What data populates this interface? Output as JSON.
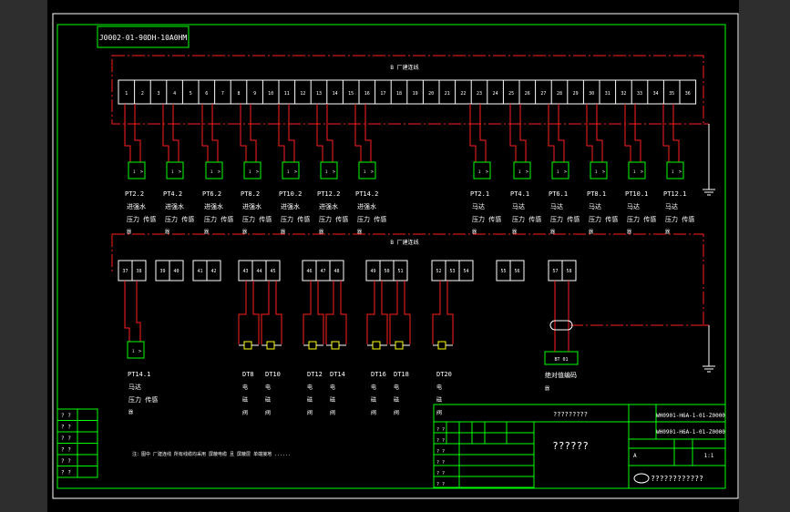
{
  "colors": {
    "frame": "#ffffff",
    "border": "#00ff00",
    "dash": "#ff2020",
    "wire": "#ff2020",
    "box_yellow": "#ffff00",
    "box_green": "#00ff00",
    "cyan": "#00ffff",
    "text": "#ffffff",
    "side": "#2e2e2e"
  },
  "header": {
    "code_tag": "J0002-01-90DH-10A0HM"
  },
  "top_bus": {
    "label": "B  厂建连线",
    "terminals": [
      "1",
      "2",
      "3",
      "4",
      "5",
      "6",
      "7",
      "8",
      "9",
      "10",
      "11",
      "12",
      "13",
      "14",
      "15",
      "16",
      "17",
      "18",
      "19",
      "20",
      "21",
      "22",
      "23",
      "24",
      "25",
      "26",
      "27",
      "28",
      "29",
      "30",
      "31",
      "32",
      "33",
      "34",
      "35",
      "36"
    ]
  },
  "top_sensors": [
    {
      "id": "PT2.2",
      "l1": "进强水",
      "l2": "压力 传感",
      "l3": "器"
    },
    {
      "id": "PT4.2",
      "l1": "进强水",
      "l2": "压力 传感",
      "l3": "器"
    },
    {
      "id": "PT6.2",
      "l1": "进强水",
      "l2": "压力 传感",
      "l3": "器"
    },
    {
      "id": "PT8.2",
      "l1": "进强水",
      "l2": "压力 传感",
      "l3": "器"
    },
    {
      "id": "PT10.2",
      "l1": "进强水",
      "l2": "压力 传感",
      "l3": "器"
    },
    {
      "id": "PT12.2",
      "l1": "进强水",
      "l2": "压力 传感",
      "l3": "器"
    },
    {
      "id": "PT14.2",
      "l1": "进强水",
      "l2": "压力 传感",
      "l3": "器"
    },
    {
      "id": "PT2.1",
      "l1": "马达",
      "l2": "压力 传感",
      "l3": "器"
    },
    {
      "id": "PT4.1",
      "l1": "马达",
      "l2": "压力 传感",
      "l3": "器"
    },
    {
      "id": "PT6.1",
      "l1": "马达",
      "l2": "压力 传感",
      "l3": "器"
    },
    {
      "id": "PT8.1",
      "l1": "马达",
      "l2": "压力 传感",
      "l3": "器"
    },
    {
      "id": "PT10.1",
      "l1": "马达",
      "l2": "压力 传感",
      "l3": "器"
    },
    {
      "id": "PT12.1",
      "l1": "马达",
      "l2": "压力 传感",
      "l3": "器"
    }
  ],
  "bottom_bus": {
    "label": "B  厂建连线",
    "groups": [
      [
        "37",
        "38"
      ],
      [
        "39",
        "40"
      ],
      [
        "41",
        "42"
      ],
      [
        "43",
        "44",
        "45"
      ],
      [
        "46",
        "47",
        "48"
      ],
      [
        "49",
        "50",
        "51"
      ],
      [
        "52",
        "53",
        "54"
      ],
      [
        "55",
        "56"
      ],
      [
        "57",
        "58"
      ]
    ]
  },
  "bottom_sensor": {
    "id": "PT14.1",
    "l1": "马达",
    "l2": "压力 传感",
    "l3": "器"
  },
  "valves": [
    {
      "id": "DT8",
      "lines": [
        "电",
        "磁",
        "阀"
      ]
    },
    {
      "id": "DT10",
      "lines": [
        "电",
        "磁",
        "阀"
      ]
    },
    {
      "id": "DT12",
      "lines": [
        "电",
        "磁",
        "阀"
      ]
    },
    {
      "id": "DT14",
      "lines": [
        "电",
        "磁",
        "阀"
      ]
    },
    {
      "id": "DT16",
      "lines": [
        "电",
        "磁",
        "阀"
      ]
    },
    {
      "id": "DT18",
      "lines": [
        "电",
        "磁",
        "阀"
      ]
    },
    {
      "id": "DT20",
      "lines": [
        "电",
        "磁",
        "阀"
      ]
    }
  ],
  "encoder": {
    "box": "BT 01",
    "label": "绝对值编码",
    "l2": "器"
  },
  "note": "注：图中 厂建连线 所有线缆均采用 屏蔽电缆 且 屏蔽层 单端接地 ......",
  "title_block": {
    "center_top": "?????????",
    "center_main": "??????",
    "code1": "WH0901-H6A-1-01-Z0000",
    "code2": "WH0901-H6A-1-01-Z0000",
    "scale_a": "A",
    "scale_b": "1:1",
    "company": "????????????",
    "left_marks": [
      "? ?",
      "? ?",
      "? ?",
      "? ?",
      "? ?",
      "? ?"
    ],
    "grid_marks": [
      "? ?",
      "? ?",
      "? ?",
      "? ?",
      "? ?",
      "? ?"
    ]
  }
}
